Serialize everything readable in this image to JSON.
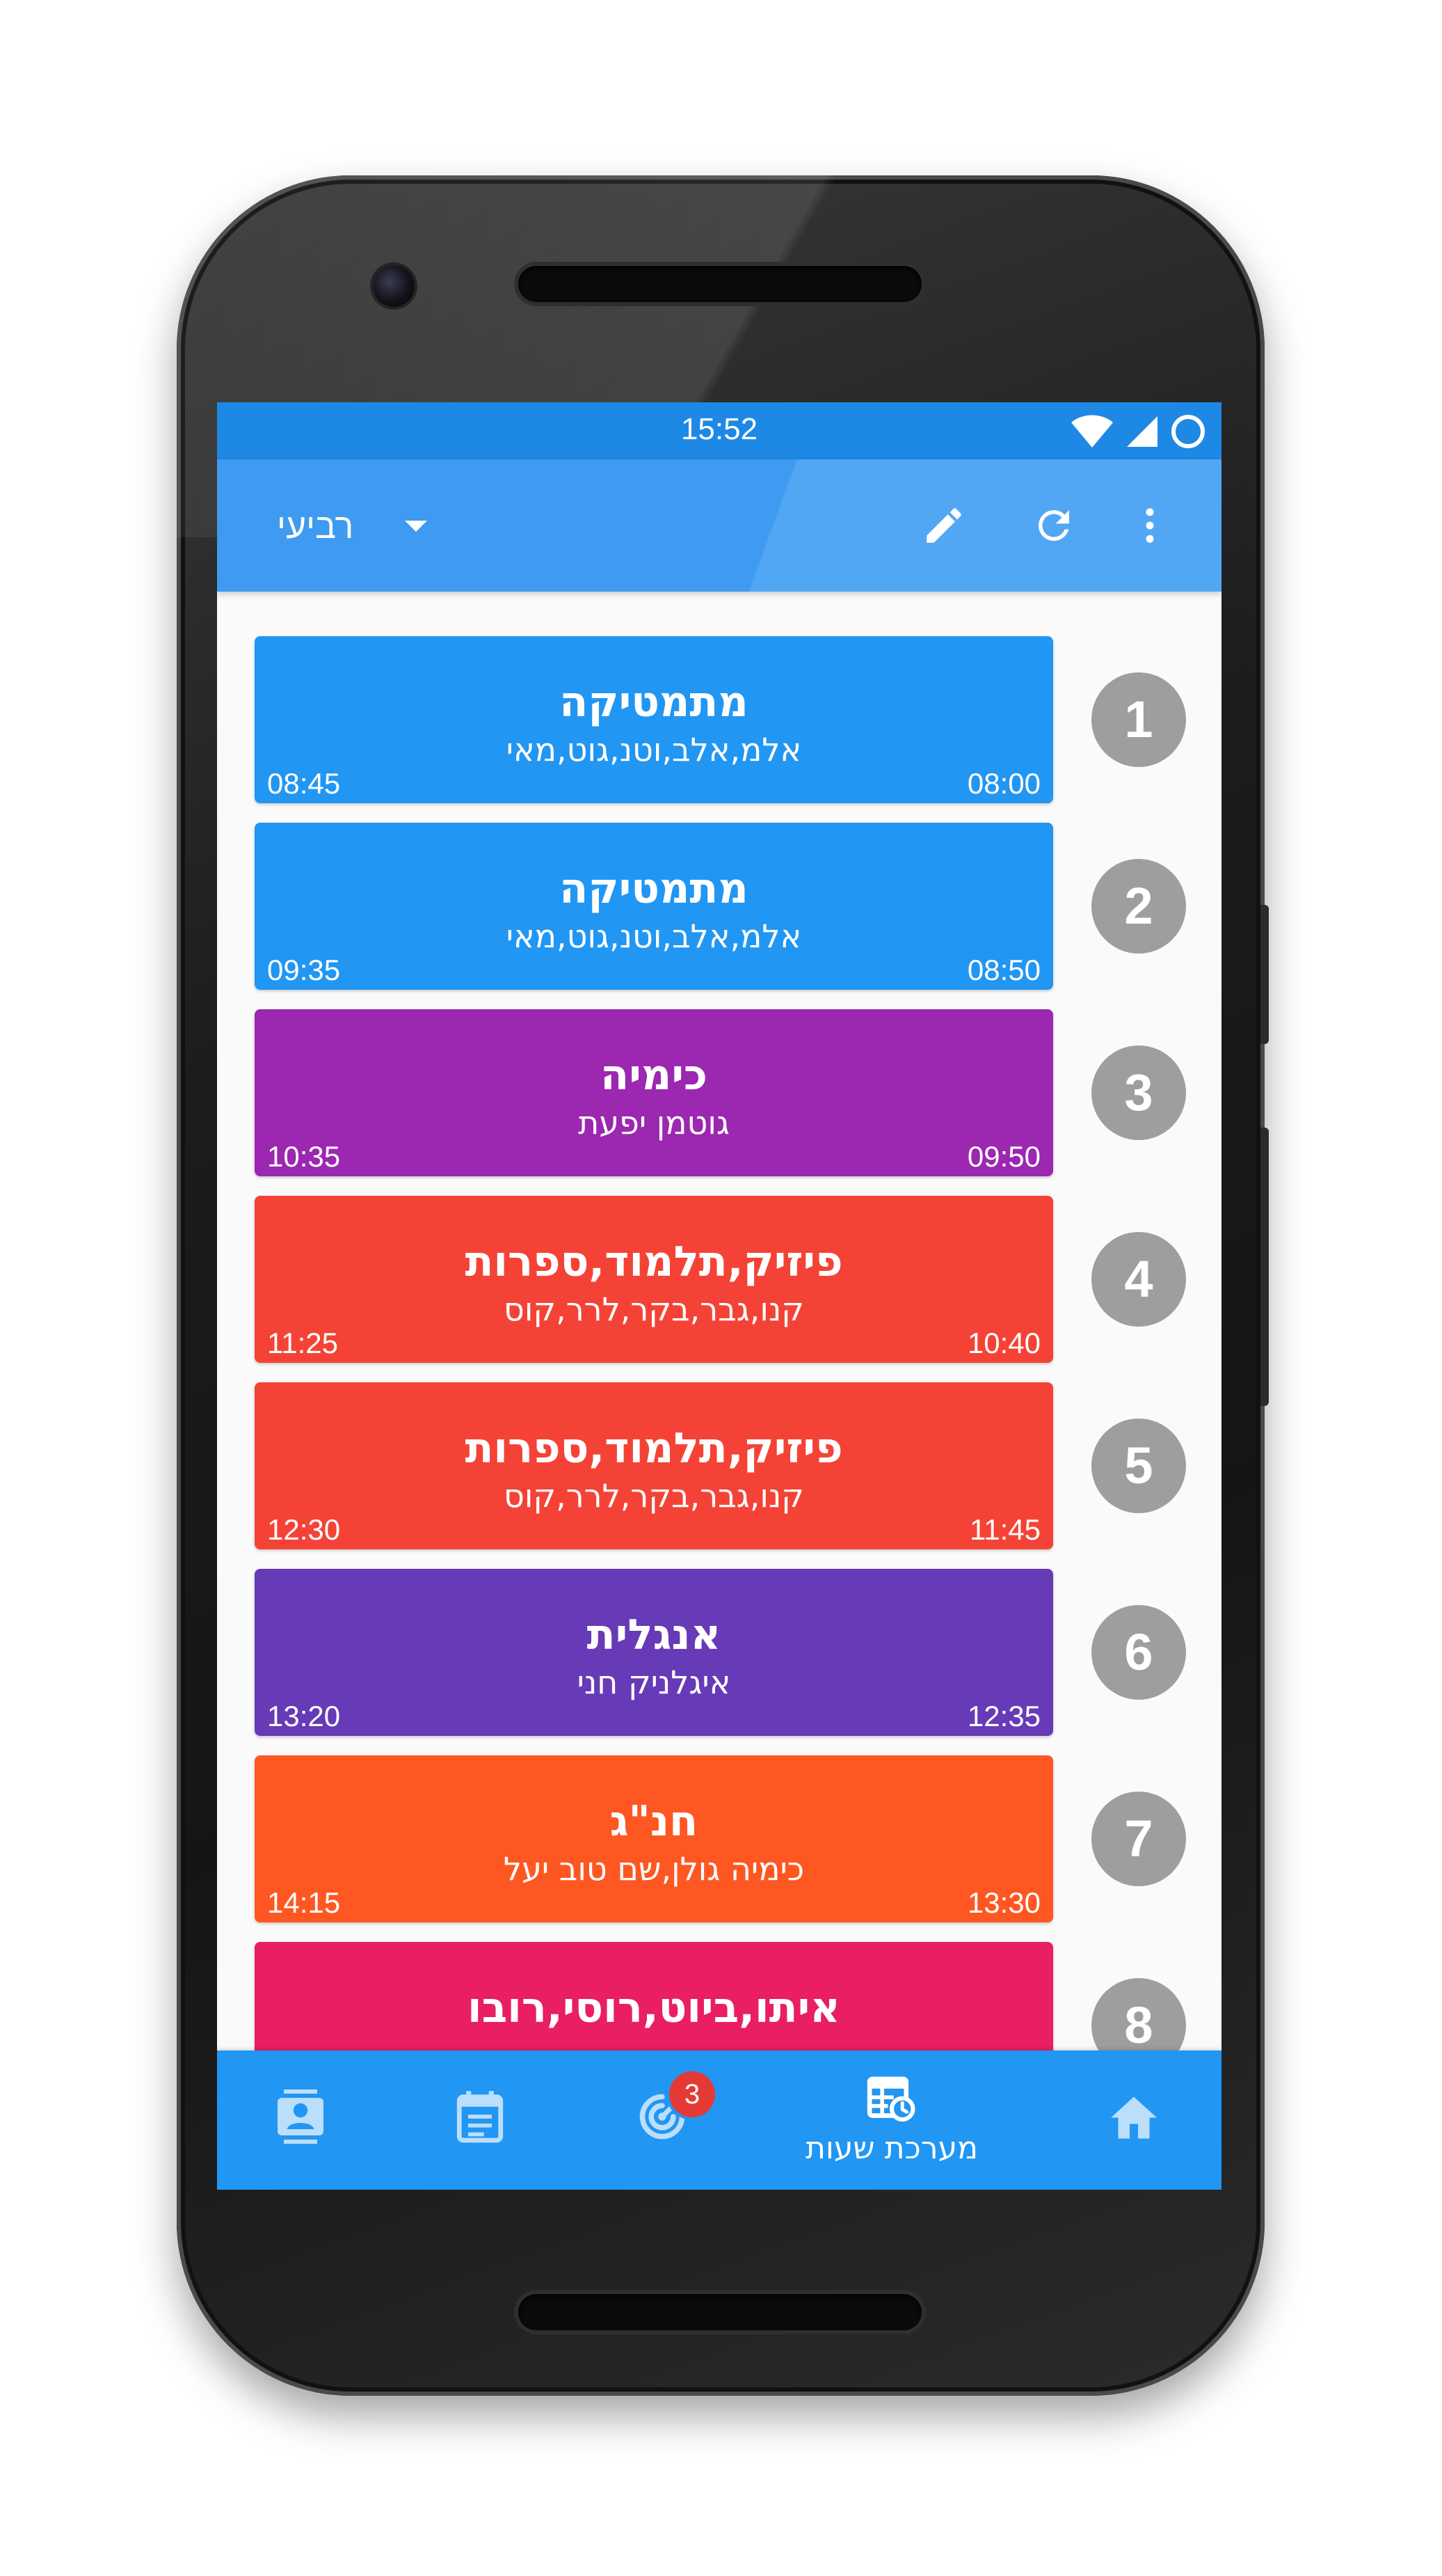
{
  "status_bar": {
    "time": "15:52",
    "icons": [
      "wifi-icon",
      "cell-signal-icon",
      "circle-status-icon"
    ]
  },
  "app_bar": {
    "day": "רביעי",
    "actions": [
      "edit-icon",
      "refresh-icon",
      "more-vert-icon"
    ]
  },
  "lessons": [
    {
      "period": "1",
      "subject": "מתמטיקה",
      "teacher": "אלמ,אלב,וטנ,גוט,מאי",
      "start": "08:00",
      "end": "08:45",
      "color": "#2196f3"
    },
    {
      "period": "2",
      "subject": "מתמטיקה",
      "teacher": "אלמ,אלב,וטנ,גוט,מאי",
      "start": "08:50",
      "end": "09:35",
      "color": "#2196f3"
    },
    {
      "period": "3",
      "subject": "כימיה",
      "teacher": "גוטמן יפעת",
      "start": "09:50",
      "end": "10:35",
      "color": "#9c27b0"
    },
    {
      "period": "4",
      "subject": "פיזיק,תלמוד,ספרות",
      "teacher": "קנו,גבר,בקר,לרר,קוס",
      "start": "10:40",
      "end": "11:25",
      "color": "#f44336"
    },
    {
      "period": "5",
      "subject": "פיזיק,תלמוד,ספרות",
      "teacher": "קנו,גבר,בקר,לרר,קוס",
      "start": "11:45",
      "end": "12:30",
      "color": "#f44336"
    },
    {
      "period": "6",
      "subject": "אנגלית",
      "teacher": "איגלניק חני",
      "start": "12:35",
      "end": "13:20",
      "color": "#673ab7"
    },
    {
      "period": "7",
      "subject": "חנ\"ג",
      "teacher": "כימיה גולן,שם טוב יעל",
      "start": "13:30",
      "end": "14:15",
      "color": "#ff5722"
    },
    {
      "period": "8",
      "subject": "איתו,ביוט,רוסי,רובו",
      "teacher": "",
      "start": "",
      "end": "",
      "color": "#e91e63"
    }
  ],
  "bottom_nav": {
    "items": [
      {
        "icon": "contacts-icon",
        "label": ""
      },
      {
        "icon": "calendar-icon",
        "label": ""
      },
      {
        "icon": "radar-icon",
        "label": "",
        "badge": "3"
      },
      {
        "icon": "timetable-icon",
        "label": "מערכת שעות"
      },
      {
        "icon": "home-icon",
        "label": ""
      }
    ]
  }
}
